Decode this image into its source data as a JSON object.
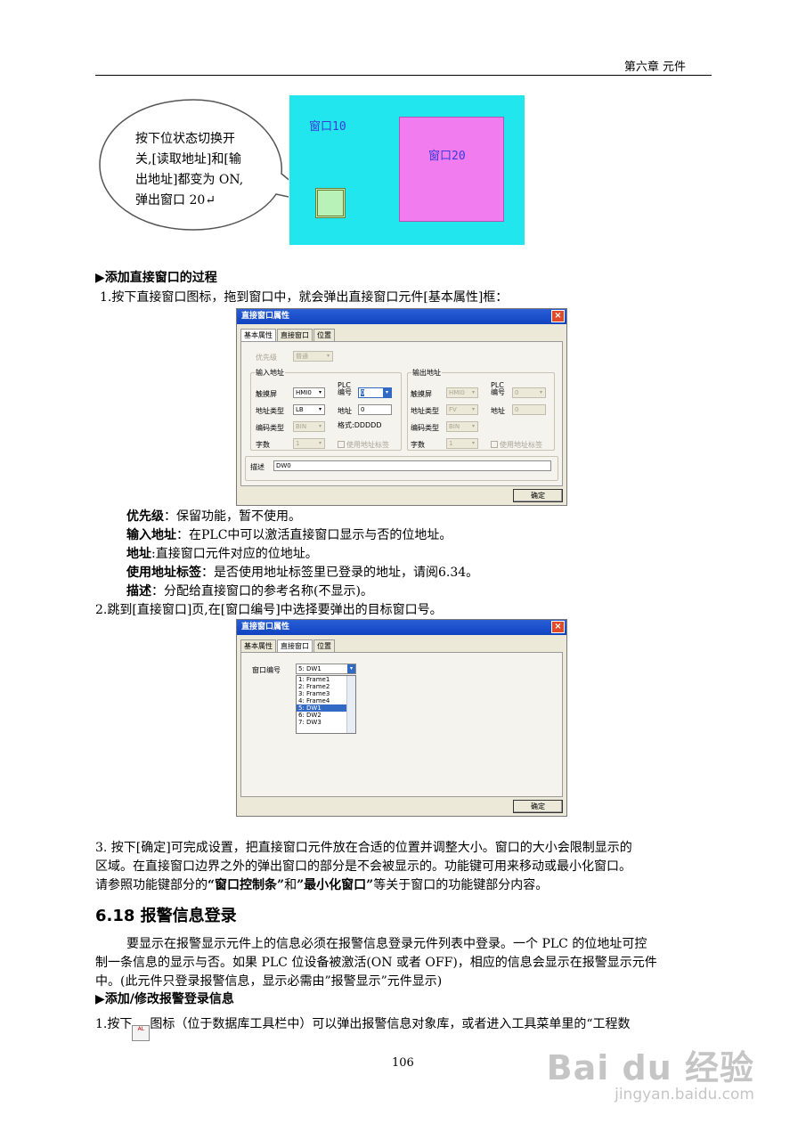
{
  "header": {
    "chapter": "第六章  元件"
  },
  "illustration": {
    "window10": "窗口10",
    "window20": "窗口20",
    "callout": [
      "按下位状态切换开",
      "关,[读取地址]和[输",
      "出地址]都变为 ON,",
      "弹出窗口 20↵"
    ]
  },
  "section1": {
    "heading": "▶添加直接窗口的过程",
    "step1": "1.按下直接窗口图标，拖到窗口中，就会弹出直接窗口元件[基本属性]框："
  },
  "dialog1": {
    "title": "直接窗口属性",
    "close": "×",
    "tabs": [
      "基本属性",
      "直接窗口",
      "位置"
    ],
    "priority_label": "优先级",
    "priority_value": "普通",
    "input": {
      "title": "输入地址",
      "touch_label": "触摸屏",
      "touch_value": "HMI0",
      "plc_label": "PLC\n编号",
      "plc_value": "0",
      "type_label": "地址类型",
      "type_value": "LB",
      "addr_label": "地址",
      "addr_value": "0",
      "code_label": "编码类型",
      "code_value": "BIN",
      "format": "格式:DDDDD",
      "count_label": "字数",
      "count_value": "1",
      "tag_label": "使用地址标签"
    },
    "output": {
      "title": "输出地址",
      "touch_label": "触摸屏",
      "touch_value": "HMI0",
      "plc_label": "PLC\n编号",
      "plc_value": "0",
      "type_label": "地址类型",
      "type_value": "FV",
      "addr_label": "地址",
      "addr_value": "0",
      "code_label": "编码类型",
      "code_value": "BIN",
      "count_label": "字数",
      "count_value": "1",
      "tag_label": "使用地址标签"
    },
    "desc_label": "描述",
    "desc_value": "DW0",
    "ok": "确定"
  },
  "definitions": [
    {
      "term": "优先级",
      "text": "：保留功能，暂不使用。"
    },
    {
      "term": "输入地址",
      "text": "：在PLC中可以激活直接窗口显示与否的位地址。"
    },
    {
      "term": "地址",
      "text": ":直接窗口元件对应的位地址。"
    },
    {
      "term": "使用地址标签",
      "text": "：是否使用地址标签里已登录的地址，请阅6.34。"
    },
    {
      "term": "描述",
      "text": "：分配给直接窗口的参考名称(不显示)。"
    }
  ],
  "step2": "2.跳到[直接窗口]页,在[窗口编号]中选择要弹出的目标窗口号。",
  "dialog2": {
    "title": "直接窗口属性",
    "close": "×",
    "tabs": [
      "基本属性",
      "直接窗口",
      "位置"
    ],
    "window_no_label": "窗口编号",
    "selected": "5: DW1",
    "options": [
      "1: Frame1",
      "2: Frame2",
      "3: Frame3",
      "4: Frame4",
      "5: DW1",
      "6: DW2",
      "7: DW3"
    ],
    "ok": "确定"
  },
  "step3": {
    "line1": "3.  按下[确定]可完成设置，把直接窗口元件放在合适的位置并调整大小。窗口的大小会限制显示的",
    "line2": "区域。在直接窗口边界之外的弹出窗口的部分是不会被显示的。功能键可用来移动或最小化窗口。",
    "line3_a": "请参照功能键部分的",
    "line3_b": "“窗口控制条”",
    "line3_c": "和",
    "line3_d": "”最小化窗口”",
    "line3_e": "等关于窗口的功能键部分内容。"
  },
  "section2": {
    "title": "6.18 报警信息登录",
    "p1": "要显示在报警显示元件上的信息必须在报警信息登录元件列表中登录。一个 PLC 的位地址可控",
    "p2": "制一条信息的显示与否。如果 PLC 位设备被激活(ON 或者 OFF)，相应的信息会显示在报警显示元件",
    "p3": "中。(此元件只登录报警信息，显示必需由”报警显示”元件显示)",
    "heading": "▶添加/修改报警登录信息",
    "step1_a": "1.按下",
    "step1_icon": "AL",
    "step1_b": "图标（位于数据库工具栏中）可以弹出报警信息对象库，或者进入工具菜单里的“工程数"
  },
  "page_number": "106",
  "watermark": {
    "brand": "Bai du 经验",
    "url": "jingyan.baidu.com"
  }
}
